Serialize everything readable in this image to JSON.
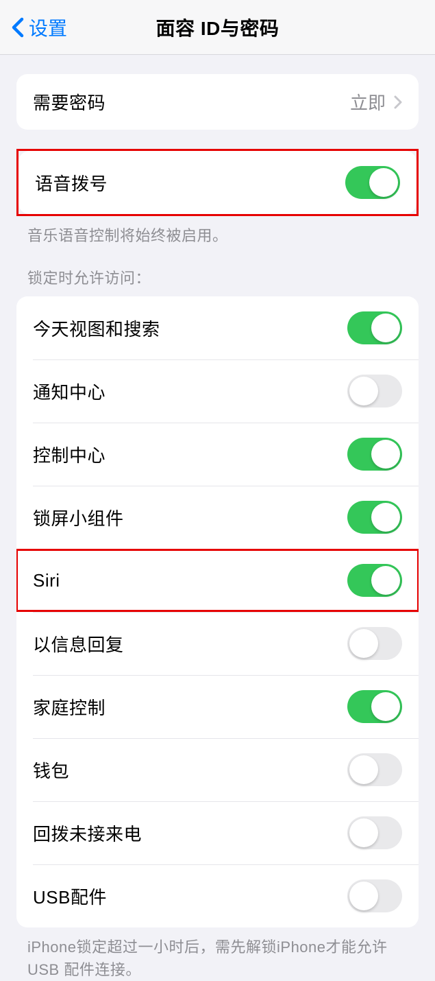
{
  "header": {
    "back_label": "设置",
    "title": "面容 ID与密码"
  },
  "group1": {
    "require_passcode": {
      "label": "需要密码",
      "value": "立即"
    }
  },
  "group2": {
    "voice_dial": {
      "label": "语音拨号",
      "on": true
    },
    "footer": "音乐语音控制将始终被启用。"
  },
  "group3": {
    "header": "锁定时允许访问：",
    "items": [
      {
        "label": "今天视图和搜索",
        "on": true,
        "name": "today-view-search-toggle"
      },
      {
        "label": "通知中心",
        "on": false,
        "name": "notification-center-toggle"
      },
      {
        "label": "控制中心",
        "on": true,
        "name": "control-center-toggle"
      },
      {
        "label": "锁屏小组件",
        "on": true,
        "name": "lock-screen-widgets-toggle"
      },
      {
        "label": "Siri",
        "on": true,
        "name": "siri-toggle",
        "highlight": true
      },
      {
        "label": "以信息回复",
        "on": false,
        "name": "reply-with-message-toggle"
      },
      {
        "label": "家庭控制",
        "on": true,
        "name": "home-control-toggle"
      },
      {
        "label": "钱包",
        "on": false,
        "name": "wallet-toggle"
      },
      {
        "label": "回拨未接来电",
        "on": false,
        "name": "return-missed-calls-toggle"
      },
      {
        "label": "USB配件",
        "on": false,
        "name": "usb-accessories-toggle"
      }
    ],
    "footer": "iPhone锁定超过一小时后，需先解锁iPhone才能允许USB 配件连接。"
  }
}
